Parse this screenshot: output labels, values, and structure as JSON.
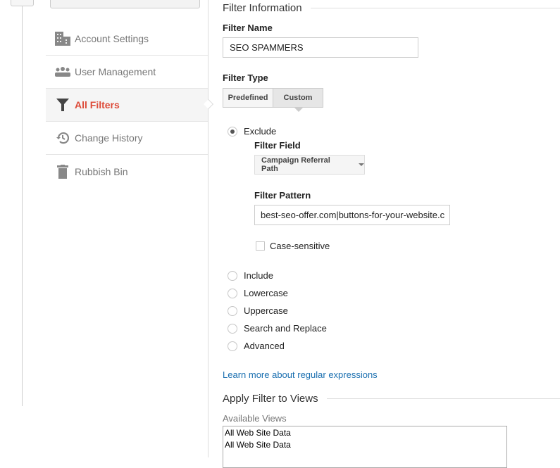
{
  "sidebar": {
    "items": [
      {
        "label": "Account Settings",
        "icon": "building-icon",
        "active": false
      },
      {
        "label": "User Management",
        "icon": "users-icon",
        "active": false
      },
      {
        "label": "All Filters",
        "icon": "filter-icon",
        "active": true
      },
      {
        "label": "Change History",
        "icon": "history-icon",
        "active": false
      },
      {
        "label": "Rubbish Bin",
        "icon": "trash-icon",
        "active": false
      }
    ]
  },
  "main": {
    "filter_info_title": "Filter Information",
    "filter_name_label": "Filter Name",
    "filter_name_value": "SEO SPAMMERS",
    "filter_type_label": "Filter Type",
    "filter_type_options": [
      "Predefined",
      "Custom"
    ],
    "filter_type_selected": "Custom",
    "exclude_label": "Exclude",
    "filter_field_label": "Filter Field",
    "filter_field_value": "Campaign Referral Path",
    "filter_pattern_label": "Filter Pattern",
    "filter_pattern_value": "best-seo-offer.com|buttons-for-your-website.c",
    "case_sensitive_label": "Case-sensitive",
    "case_sensitive_checked": false,
    "other_types": [
      "Include",
      "Lowercase",
      "Uppercase",
      "Search and Replace",
      "Advanced"
    ],
    "learn_more_link": "Learn more about regular expressions",
    "apply_title": "Apply Filter to Views",
    "available_views_label": "Available Views",
    "available_views": [
      "All Web Site Data",
      "All Web Site Data"
    ]
  },
  "colors": {
    "active": "#dd4b39",
    "link": "#1a6fb0"
  }
}
